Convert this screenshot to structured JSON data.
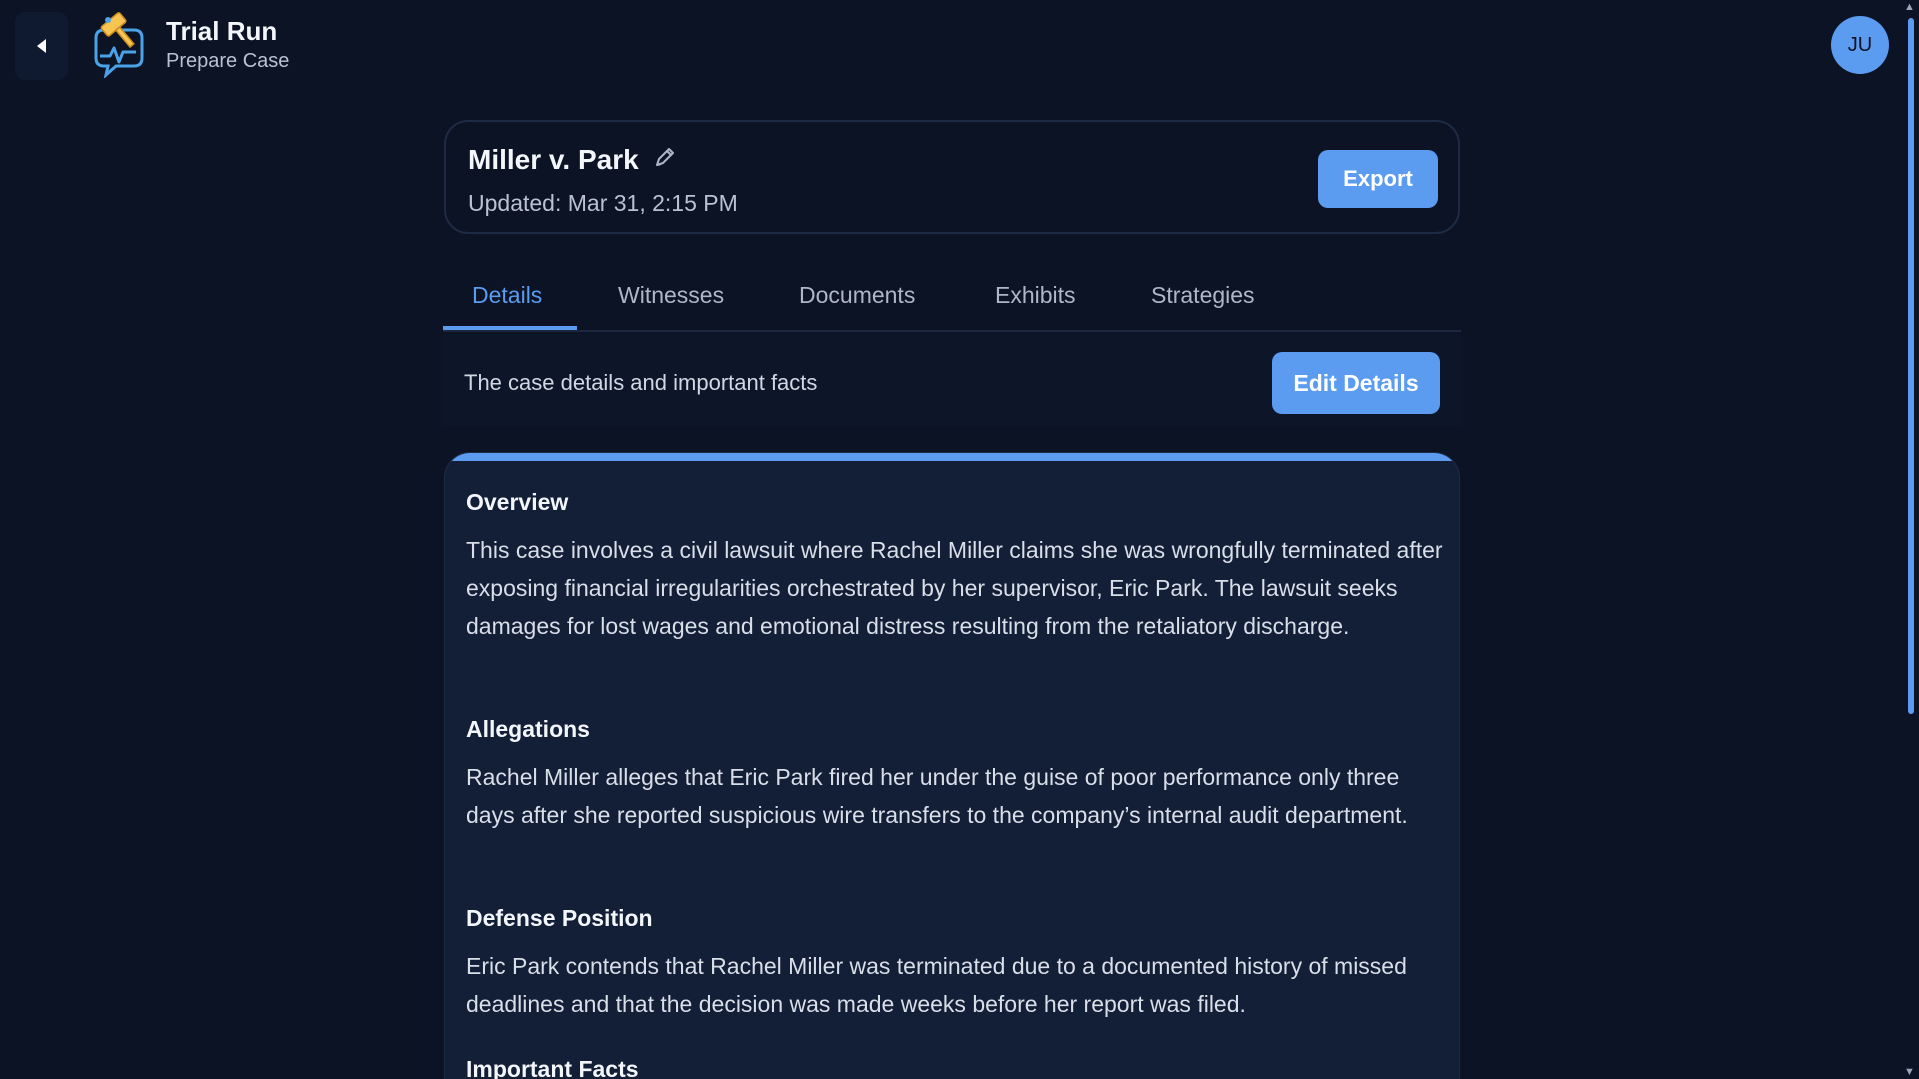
{
  "app": {
    "title": "Trial Run",
    "subtitle": "Prepare Case",
    "user_initials": "JU"
  },
  "case": {
    "title": "Miller v. Park",
    "updated": "Updated: Mar 31, 2:15 PM",
    "export_label": "Export"
  },
  "tabs": [
    {
      "label": "Details",
      "active": true
    },
    {
      "label": "Witnesses",
      "active": false
    },
    {
      "label": "Documents",
      "active": false
    },
    {
      "label": "Exhibits",
      "active": false
    },
    {
      "label": "Strategies",
      "active": false
    }
  ],
  "details": {
    "description": "The case details and important facts",
    "edit_label": "Edit Details",
    "sections": [
      {
        "title": "Overview",
        "body": "This case involves a civil lawsuit where Rachel Miller claims she was wrongfully terminated after exposing financial irregularities orchestrated by her supervisor, Eric Park. The lawsuit seeks damages for lost wages and emotional distress resulting from the retaliatory discharge."
      },
      {
        "title": "Allegations",
        "body": "Rachel Miller alleges that Eric Park fired her under the guise of poor performance only three days after she reported suspicious wire transfers to the company’s internal audit department."
      },
      {
        "title": "Defense Position",
        "body": "Eric Park contends that Rachel Miller was terminated due to a documented history of missed deadlines and that the decision was made weeks before her report was filed."
      },
      {
        "title": "Important Facts",
        "body": ""
      }
    ]
  },
  "icons": {
    "back": "chevron-left-icon",
    "logo": "gavel-chat-logo-icon",
    "edit": "pencil-icon"
  },
  "colors": {
    "background": "#0b1324",
    "accent": "#5b9bf0",
    "card": "#131e37",
    "logo_yellow": "#f5c451",
    "logo_blue": "#4aa3e8"
  }
}
